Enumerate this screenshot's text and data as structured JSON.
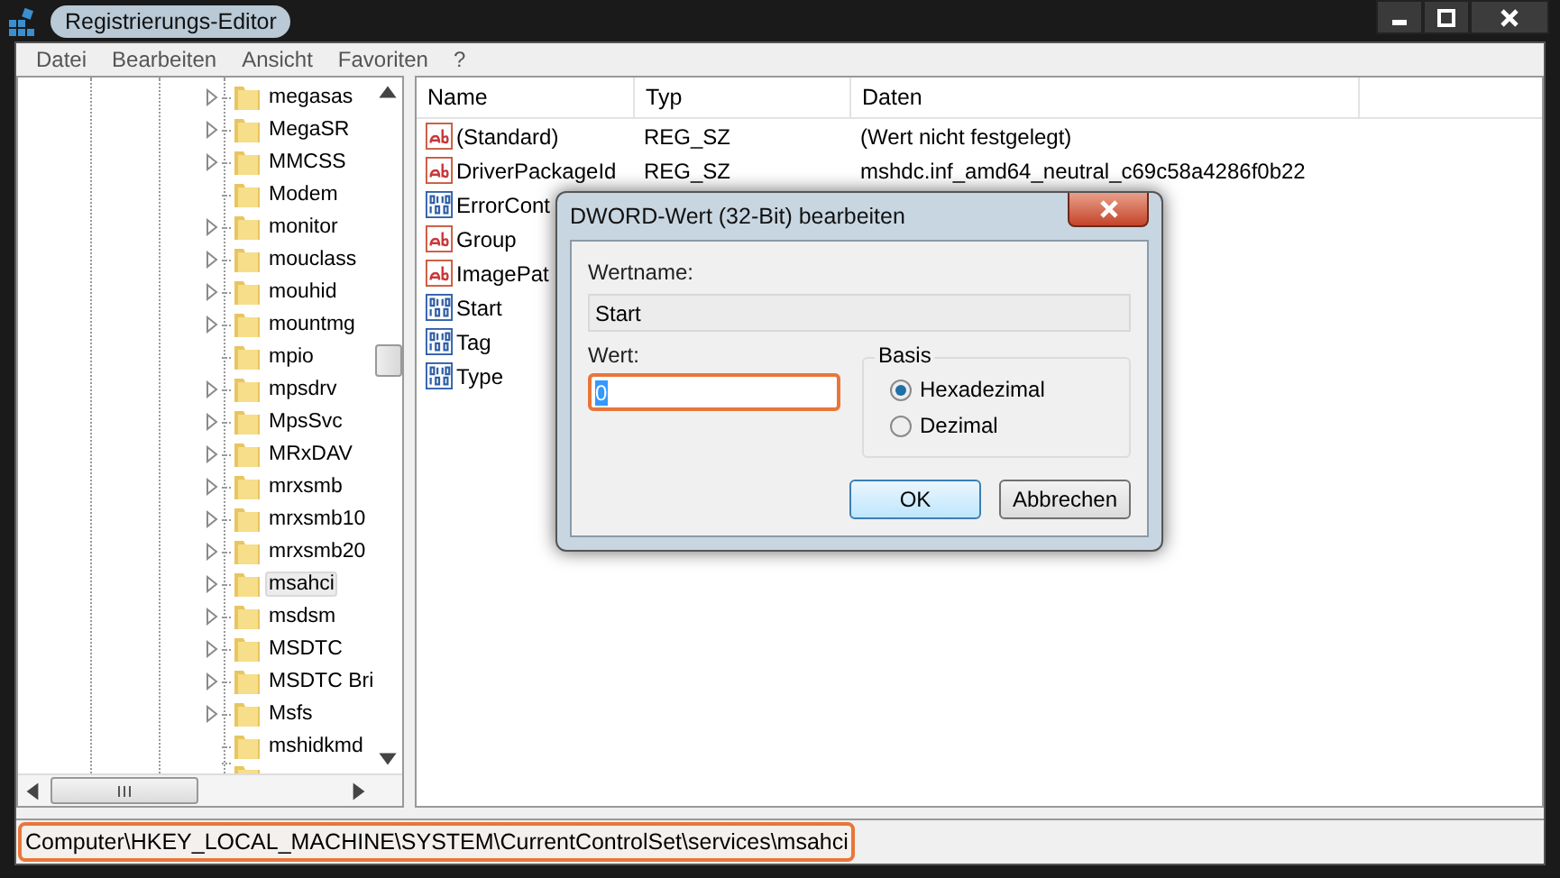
{
  "window": {
    "title": "Registrierungs-Editor"
  },
  "menu": [
    "Datei",
    "Bearbeiten",
    "Ansicht",
    "Favoriten",
    "?"
  ],
  "tree": [
    {
      "label": "megasas",
      "expandable": true,
      "selected": false
    },
    {
      "label": "MegaSR",
      "expandable": true,
      "selected": false
    },
    {
      "label": "MMCSS",
      "expandable": true,
      "selected": false
    },
    {
      "label": "Modem",
      "expandable": false,
      "selected": false
    },
    {
      "label": "monitor",
      "expandable": true,
      "selected": false
    },
    {
      "label": "mouclass",
      "expandable": true,
      "selected": false
    },
    {
      "label": "mouhid",
      "expandable": true,
      "selected": false
    },
    {
      "label": "mountmg",
      "expandable": true,
      "selected": false
    },
    {
      "label": "mpio",
      "expandable": false,
      "selected": false
    },
    {
      "label": "mpsdrv",
      "expandable": true,
      "selected": false
    },
    {
      "label": "MpsSvc",
      "expandable": true,
      "selected": false
    },
    {
      "label": "MRxDAV",
      "expandable": true,
      "selected": false
    },
    {
      "label": "mrxsmb",
      "expandable": true,
      "selected": false
    },
    {
      "label": "mrxsmb10",
      "expandable": true,
      "selected": false
    },
    {
      "label": "mrxsmb20",
      "expandable": true,
      "selected": false
    },
    {
      "label": "msahci",
      "expandable": true,
      "selected": true
    },
    {
      "label": "msdsm",
      "expandable": true,
      "selected": false
    },
    {
      "label": "MSDTC",
      "expandable": true,
      "selected": false
    },
    {
      "label": "MSDTC Bri",
      "expandable": true,
      "selected": false
    },
    {
      "label": "Msfs",
      "expandable": true,
      "selected": false
    },
    {
      "label": "mshidkmd",
      "expandable": false,
      "selected": false
    }
  ],
  "table": {
    "columns": [
      "Name",
      "Typ",
      "Daten"
    ],
    "rows": [
      {
        "kind": "sz",
        "name": "(Standard)",
        "type": "REG_SZ",
        "data": "(Wert nicht festgelegt)"
      },
      {
        "kind": "sz",
        "name": "DriverPackageId",
        "type": "REG_SZ",
        "data": "mshdc.inf_amd64_neutral_c69c58a4286f0b22"
      },
      {
        "kind": "dword",
        "name": "ErrorCont"
      },
      {
        "kind": "sz",
        "name": "Group"
      },
      {
        "kind": "sz",
        "name": "ImagePat"
      },
      {
        "kind": "dword",
        "name": "Start"
      },
      {
        "kind": "dword",
        "name": "Tag"
      },
      {
        "kind": "dword",
        "name": "Type"
      }
    ]
  },
  "status_bar": "Computer\\HKEY_LOCAL_MACHINE\\SYSTEM\\CurrentControlSet\\services\\msahci",
  "dialog": {
    "title": "DWORD-Wert (32-Bit) bearbeiten",
    "name_label": "Wertname:",
    "name_value": "Start",
    "value_label": "Wert:",
    "value": "0",
    "base_label": "Basis",
    "bases": [
      {
        "label": "Hexadezimal",
        "selected": true
      },
      {
        "label": "Dezimal",
        "selected": false
      }
    ],
    "buttons": [
      "OK",
      "Abbrechen"
    ]
  }
}
